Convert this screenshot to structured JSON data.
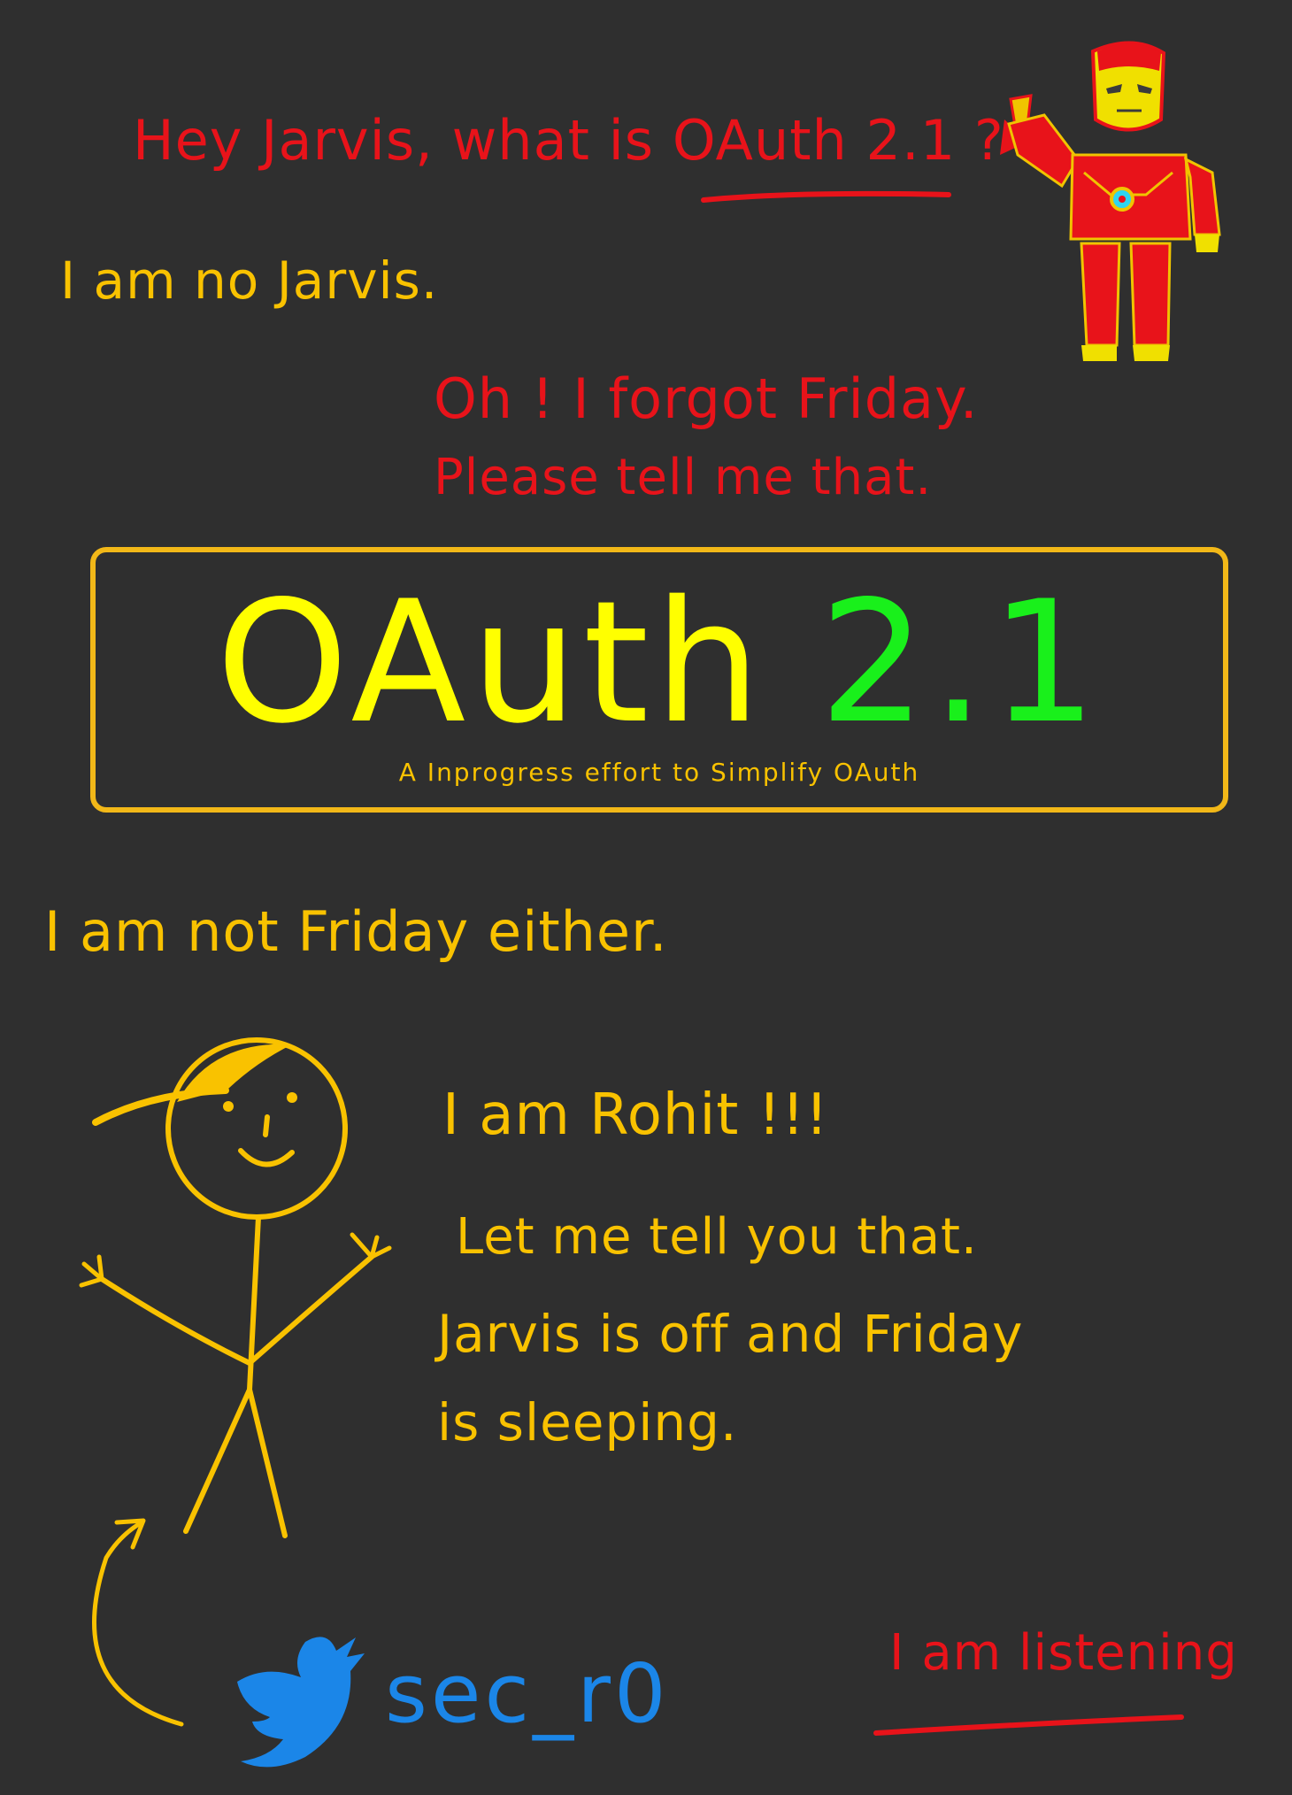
{
  "lines": {
    "question": "Hey Jarvis, what is OAuth 2.1 ?",
    "no_jarvis": "I am no Jarvis.",
    "forgot_friday": "Oh ! I forgot Friday.",
    "please_tell": "Please tell me that.",
    "not_friday": "I am not Friday either.",
    "i_am_rohit": "I am Rohit !!!",
    "let_me_tell": "Let me tell you that.",
    "jarvis_off": "Jarvis is off and Friday",
    "is_sleeping": "is sleeping.",
    "listening": "I am listening"
  },
  "title_box": {
    "title_word": "OAuth",
    "title_version": "2.1",
    "subtitle": "A Inprogress effort to Simplify OAuth"
  },
  "twitter": {
    "handle": "sec_r0",
    "icon": "twitter-bird-icon"
  },
  "colors": {
    "background": "#2f2f2f",
    "red_text": "#e8131a",
    "yellow_text": "#f9c200",
    "title_yellow": "#ffff00",
    "title_green": "#19f01b",
    "twitter_blue": "#1b86e8"
  }
}
